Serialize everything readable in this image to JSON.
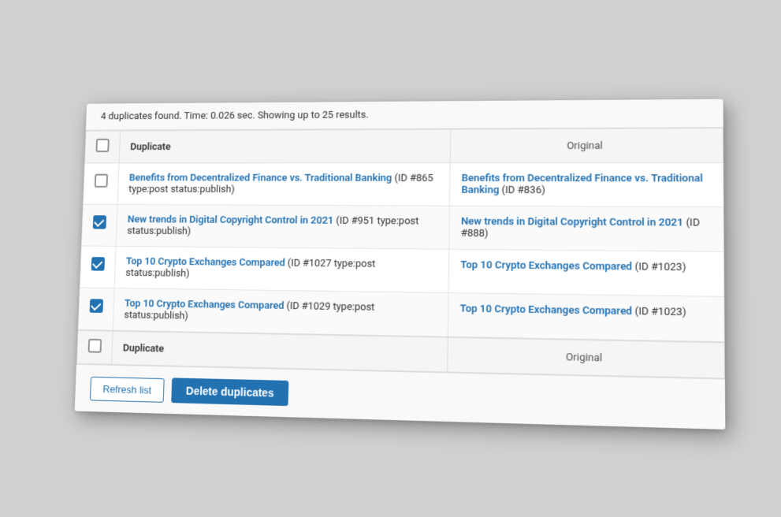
{
  "summary": {
    "text": "4 duplicates found. Time: 0.026 sec. Showing up to 25 results."
  },
  "table": {
    "col_duplicate": "Duplicate",
    "col_original": "Original",
    "rows": [
      {
        "id": "row-1",
        "checked": false,
        "duplicate_link": "Benefits from Decentralized Finance vs. Traditional Banking",
        "duplicate_meta": " (ID #865 type:post status:publish)",
        "original_link": "Benefits from Decentralized Finance vs. Traditional Banking",
        "original_meta": " (ID #836)"
      },
      {
        "id": "row-2",
        "checked": true,
        "duplicate_link": "New trends in Digital Copyright Control in 2021",
        "duplicate_meta": " (ID #951 type:post status:publish)",
        "original_link": "New trends in Digital Copyright Control in 2021",
        "original_meta": " (ID #888)"
      },
      {
        "id": "row-3",
        "checked": true,
        "duplicate_link": "Top 10 Crypto Exchanges Compared",
        "duplicate_meta": " (ID #1027 type:post status:publish)",
        "original_link": "Top 10 Crypto Exchanges Compared",
        "original_meta": " (ID #1023)"
      },
      {
        "id": "row-4",
        "checked": true,
        "duplicate_link": "Top 10 Crypto Exchanges Compared",
        "duplicate_meta": " (ID #1029 type:post status:publish)",
        "original_link": "Top 10 Crypto Exchanges Compared",
        "original_meta": " (ID #1023)"
      }
    ]
  },
  "footer": {
    "refresh_label": "Refresh list",
    "delete_label": "Delete duplicates"
  }
}
